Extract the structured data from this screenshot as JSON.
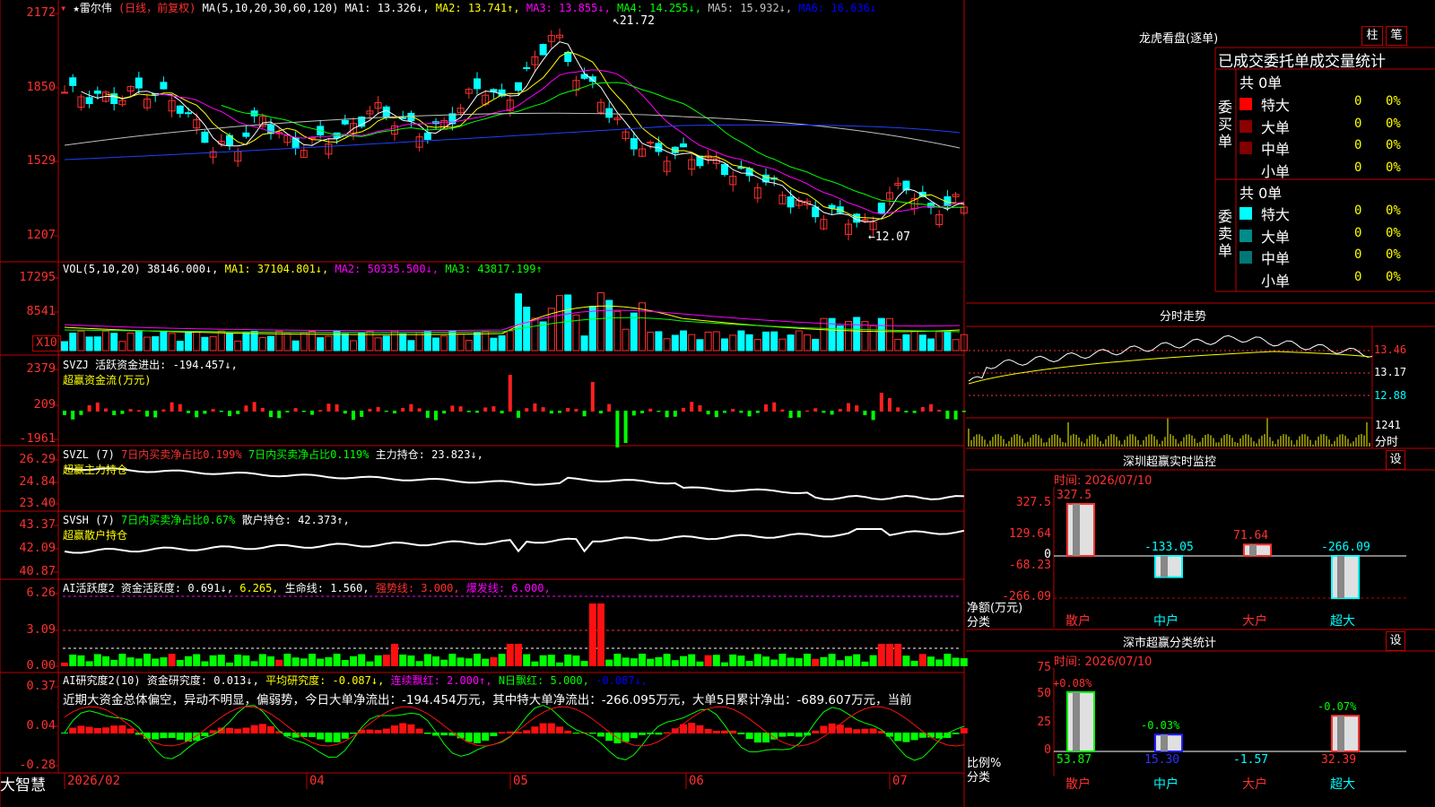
{
  "stock": {
    "name": "★雷尔伟",
    "period": "(日线，前复权)",
    "ma_header": "MA(5,10,20,30,60,120)",
    "ma": [
      {
        "label": "MA1:",
        "value": "13.326↓,",
        "color": "#ffffff"
      },
      {
        "label": "MA2:",
        "value": "13.741↑,",
        "color": "#ffff00"
      },
      {
        "label": "MA3:",
        "value": "13.855↓,",
        "color": "#ff00ff"
      },
      {
        "label": "MA4:",
        "value": "14.255↓,",
        "color": "#00ff00"
      },
      {
        "label": "MA5:",
        "value": "15.932↓,",
        "color": "#c0c0c0"
      },
      {
        "label": "MA6:",
        "value": "16.636↓",
        "color": "#0000ff"
      }
    ]
  },
  "price_axis": [
    "2172",
    "1850",
    "1529",
    "1207"
  ],
  "price_marks": {
    "high": "21.72",
    "low": "←12.07"
  },
  "vol": {
    "header": "VOL(5,10,20)",
    "value": "38146.000↓,",
    "ma1": "MA1: 37104.801↓,",
    "ma2": "MA2: 50335.500↓,",
    "ma3": "MA3: 43817.199↑",
    "axis": [
      "17295",
      "8541"
    ],
    "unit": "X10"
  },
  "svzj": {
    "header": "SVZJ  活跃资金进出: -194.457↓,",
    "sub": "超赢资金流(万元)",
    "axis": [
      "2379",
      "209",
      "-1961"
    ]
  },
  "svzl": {
    "header_a": "SVZL (7)",
    "header_b": "7日内买卖净占比0.199%",
    "header_c": "7日内买卖净占比0.119%",
    "header_d": "主力持仓: 23.823↓,",
    "sub": "超赢主力持仓",
    "axis": [
      "26.29",
      "24.84",
      "23.40"
    ]
  },
  "svsh": {
    "header_a": "SVSH (7)",
    "header_b": "7日内买卖净占比0.67%",
    "header_c": "散户持仓: 42.373↑,",
    "sub": "超赢散户持仓",
    "axis": [
      "43.37",
      "42.09",
      "40.87"
    ]
  },
  "ai_active": {
    "a": "AI活跃度2",
    "b": "资金活跃度: 0.691↓,",
    "c": "6.265,",
    "d": "生命线: 1.560,",
    "e": "强势线: 3.000,",
    "f": "爆发线: 6.000,",
    "axis": [
      "6.26",
      "3.09",
      "0.00"
    ]
  },
  "ai_research": {
    "a": "AI研究度2(10)",
    "b": "资金研究度: 0.013↓,",
    "c": "平均研究度: -0.087↓,",
    "d": "连续飘红: 2.000↑,",
    "e": "N日飘红: 5.000,",
    "f": "-0.087↓,",
    "comment": "近期大资金总体偏空，异动不明显，偏弱势，今日大单净流出：-194.454万元，其中特大单净流出：-266.095万元，大单5日累计净出：-689.607万元，当前",
    "axis": [
      "0.37",
      "0.04",
      "-0.28"
    ]
  },
  "date_axis": [
    "2026/02",
    "04",
    "05",
    "06",
    "07"
  ],
  "brand": "大智慧",
  "lhb": {
    "title": "龙虎看盘(逐单)",
    "btn_bar": "柱",
    "btn_pen": "笔",
    "subtitle": "已成交委托单成交量统计",
    "buy": {
      "label": "委买单",
      "total": "共 0单",
      "rows": [
        {
          "name": "特大",
          "v": "0",
          "p": "0%",
          "color": "#ff0000"
        },
        {
          "name": "大单",
          "v": "0",
          "p": "0%",
          "color": "#8b0000"
        },
        {
          "name": "中单",
          "v": "0",
          "p": "0%",
          "color": "#800000"
        },
        {
          "name": "小单",
          "v": "0",
          "p": "0%",
          "color": ""
        }
      ]
    },
    "sell": {
      "label": "委卖单",
      "total": "共 0单",
      "rows": [
        {
          "name": "特大",
          "v": "0",
          "p": "0%",
          "color": "#00ffff"
        },
        {
          "name": "大单",
          "v": "0",
          "p": "0%",
          "color": "#008b8b"
        },
        {
          "name": "中单",
          "v": "0",
          "p": "0%",
          "color": "#007777"
        },
        {
          "name": "小单",
          "v": "0",
          "p": "0%",
          "color": ""
        }
      ]
    }
  },
  "intraday": {
    "title": "分时走势",
    "axis": [
      "13.46",
      "13.17",
      "12.88"
    ],
    "vol_label": "1241",
    "vol_sub": "分时"
  },
  "monitor": {
    "title": "深圳超赢实时监控",
    "btn": "设",
    "time": "时间: 2026/07/10",
    "axis": [
      "327.5",
      "129.64",
      "0",
      "-68.23",
      "-266.09"
    ],
    "unit_a": "净额(万元)",
    "unit_b": "分类",
    "bars": [
      {
        "cat": "散户",
        "value": 327.5,
        "label": "327.5"
      },
      {
        "cat": "中户",
        "value": -133.05,
        "label": "-133.05"
      },
      {
        "cat": "大户",
        "value": 71.64,
        "label": "71.64"
      },
      {
        "cat": "超大",
        "value": -266.09,
        "label": "-266.09"
      }
    ]
  },
  "classify": {
    "title": "深市超赢分类统计",
    "btn": "设",
    "time": "时间: 2026/07/10",
    "axis": [
      "75",
      "50",
      "25",
      "0"
    ],
    "unit_a": "比例%",
    "unit_b": "分类",
    "bars": [
      {
        "cat": "散户",
        "value": 53.87,
        "label": "53.87",
        "pct": "+0.08%"
      },
      {
        "cat": "中户",
        "value": 15.3,
        "label": "15.30",
        "pct": "-0.03%"
      },
      {
        "cat": "大户",
        "value": -1.57,
        "label": "-1.57",
        "pct": ""
      },
      {
        "cat": "超大",
        "value": 32.39,
        "label": "32.39",
        "pct": "-0.07%"
      }
    ]
  }
}
